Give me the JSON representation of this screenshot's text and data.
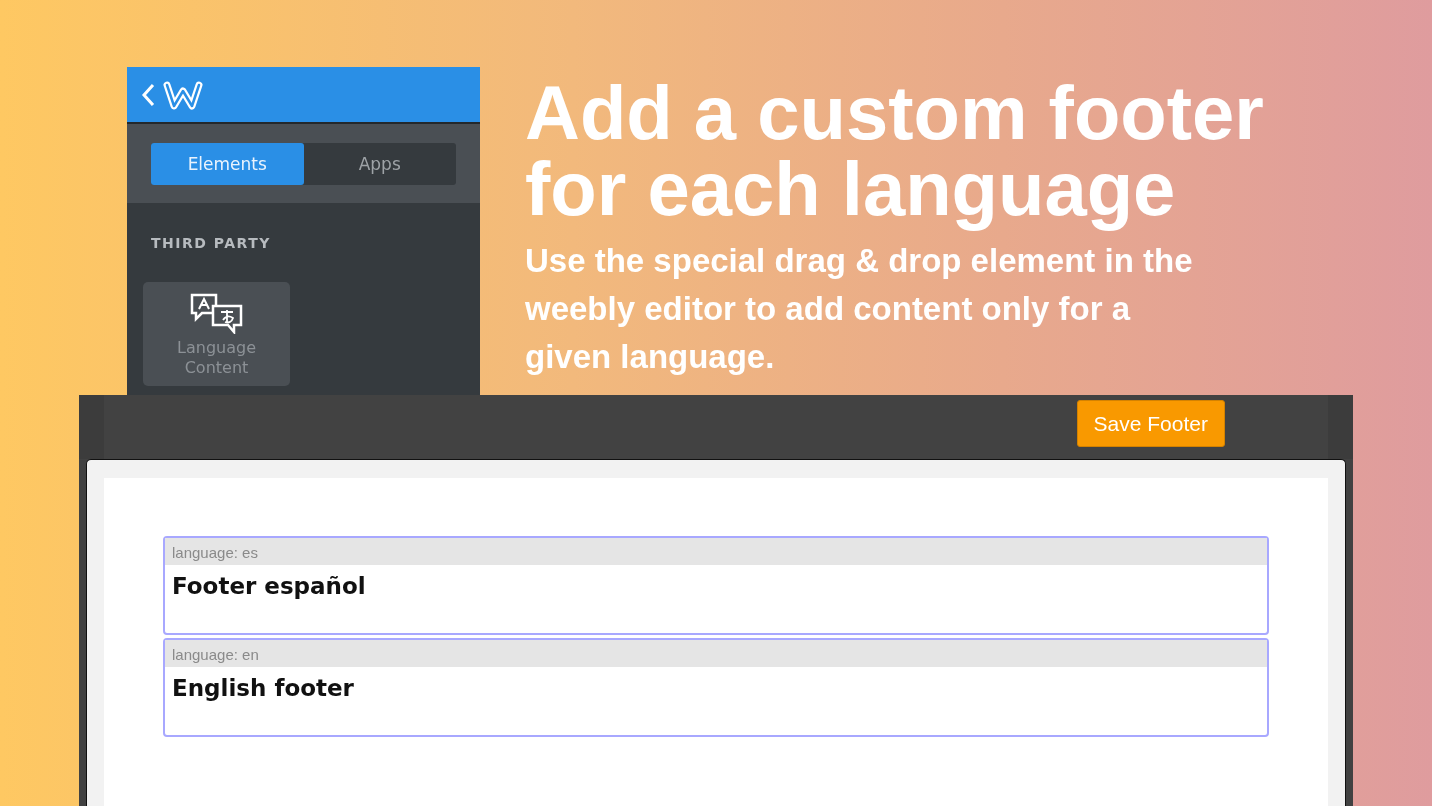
{
  "sidebar": {
    "tabs": [
      {
        "label": "Elements",
        "selected": true
      },
      {
        "label": "Apps",
        "selected": false
      }
    ],
    "section_title": "THIRD PARTY",
    "element": {
      "label": "Language Content"
    }
  },
  "headline": "Add a custom footer for each language",
  "subtitle": "Use the special drag & drop element in the weebly editor to add content only for a given language.",
  "editor": {
    "save_button": "Save Footer",
    "blocks": [
      {
        "tag": "language: es",
        "text": "Footer español"
      },
      {
        "tag": "language: en",
        "text": "English footer"
      }
    ]
  }
}
